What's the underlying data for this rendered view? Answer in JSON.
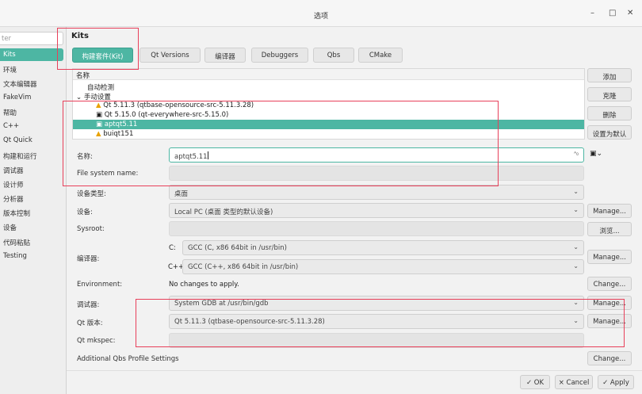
{
  "window": {
    "title": "选项",
    "minimize": "–",
    "maximize": "□",
    "close": "✕"
  },
  "sidebar": {
    "filter_placeholder": "ter",
    "items": [
      {
        "label": "Kits"
      },
      {
        "label": "环境"
      },
      {
        "label": "文本编辑器"
      },
      {
        "label": "FakeVim"
      },
      {
        "label": "帮助"
      },
      {
        "label": "C++"
      },
      {
        "label": "Qt Quick"
      },
      {
        "label": "构建和运行"
      },
      {
        "label": "调试器"
      },
      {
        "label": "设计师"
      },
      {
        "label": "分析器"
      },
      {
        "label": "版本控制"
      },
      {
        "label": "设备"
      },
      {
        "label": "代码粘贴"
      },
      {
        "label": "Testing"
      }
    ]
  },
  "main": {
    "heading": "Kits",
    "tabs": [
      {
        "label": "构建套件(Kit)"
      },
      {
        "label": "Qt Versions"
      },
      {
        "label": "编译器"
      },
      {
        "label": "Debuggers"
      },
      {
        "label": "Qbs"
      },
      {
        "label": "CMake"
      }
    ],
    "tree": {
      "header": "名称",
      "auto": "自动检测",
      "manual": "手动设置",
      "kits": [
        {
          "label": "Qt 5.11.3 (qtbase-opensource-src-5.11.3.28)",
          "icon": "warning-icon"
        },
        {
          "label": "Qt 5.15.0 (qt-everywhere-src-5.15.0)",
          "icon": "monitor-icon"
        },
        {
          "label": "aptqt5.11",
          "icon": "monitor-icon"
        },
        {
          "label": "buiqt151",
          "icon": "warning-icon"
        }
      ]
    },
    "side_buttons": {
      "add": "添加",
      "clone": "克隆",
      "remove": "删除",
      "default": "设置为默认"
    },
    "form": {
      "name_label": "名称:",
      "name_value": "aptqt5.11",
      "fs_label": "File system name:",
      "fs_value": "",
      "device_type_label": "设备类型:",
      "device_type_value": "桌面",
      "device_label": "设备:",
      "device_value": "Local PC (桌面 类型的默认设备)",
      "sysroot_label": "Sysroot:",
      "sysroot_value": "",
      "compiler_label": "编译器:",
      "c_label": "C:",
      "c_value": "GCC (C, x86 64bit in /usr/bin)",
      "cpp_label": "C++:",
      "cpp_value": "GCC (C++, x86 64bit in /usr/bin)",
      "env_label": "Environment:",
      "env_value": "No changes to apply.",
      "debugger_label": "调试器:",
      "debugger_value": "System GDB at /usr/bin/gdb",
      "qt_version_label": "Qt 版本:",
      "qt_version_value": "Qt 5.11.3 (qtbase-opensource-src-5.11.3.28)",
      "mkspec_label": "Qt mkspec:",
      "mkspec_value": "",
      "qbs_label": "Additional Qbs Profile Settings"
    },
    "buttons": {
      "manage": "Manage...",
      "browse": "浏览...",
      "change": "Change..."
    }
  },
  "bottom": {
    "ok": "✓ OK",
    "cancel": "× Cancel",
    "apply": "✓ Apply"
  },
  "colors": {
    "accent": "#4db6a3",
    "annotation": "#e8405a",
    "warning": "#e8a200"
  }
}
